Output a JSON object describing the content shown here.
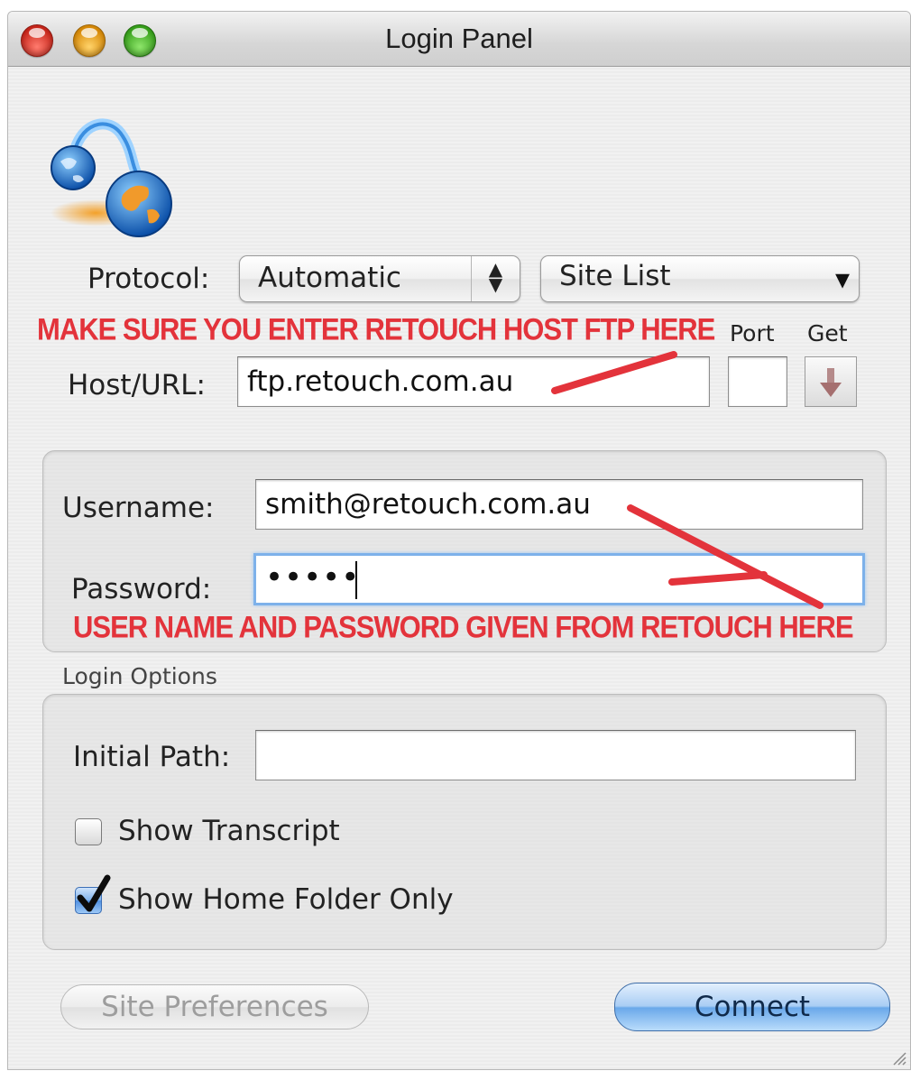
{
  "window": {
    "title": "Login Panel"
  },
  "icons": {
    "app": "ftp-globe-icon",
    "get": "download-arrow-icon",
    "checkmark": "checkmark-icon"
  },
  "protocol": {
    "label": "Protocol:",
    "value": "Automatic",
    "stepper": "up-down-arrows-icon"
  },
  "site_list": {
    "value": "Site List",
    "arrow": "▾"
  },
  "annotations": {
    "host": "MAKE SURE YOU ENTER RETOUCH HOST FTP HERE",
    "credentials": "USER NAME AND PASSWORD GIVEN FROM RETOUCH HERE",
    "color": "#e3333b"
  },
  "host": {
    "label": "Host/URL:",
    "value": "ftp.retouch.com.au",
    "port_label": "Port",
    "port_value": "",
    "get_label": "Get"
  },
  "credentials": {
    "username_label": "Username:",
    "username_value": "smith@retouch.com.au",
    "password_label": "Password:",
    "password_value": "•••••"
  },
  "login_options": {
    "title": "Login Options",
    "initial_path_label": "Initial Path:",
    "initial_path_value": "",
    "show_transcript_label": "Show Transcript",
    "show_transcript_checked": false,
    "home_folder_label": "Show Home Folder Only",
    "home_folder_checked": true
  },
  "buttons": {
    "site_preferences": "Site Preferences",
    "connect": "Connect"
  }
}
